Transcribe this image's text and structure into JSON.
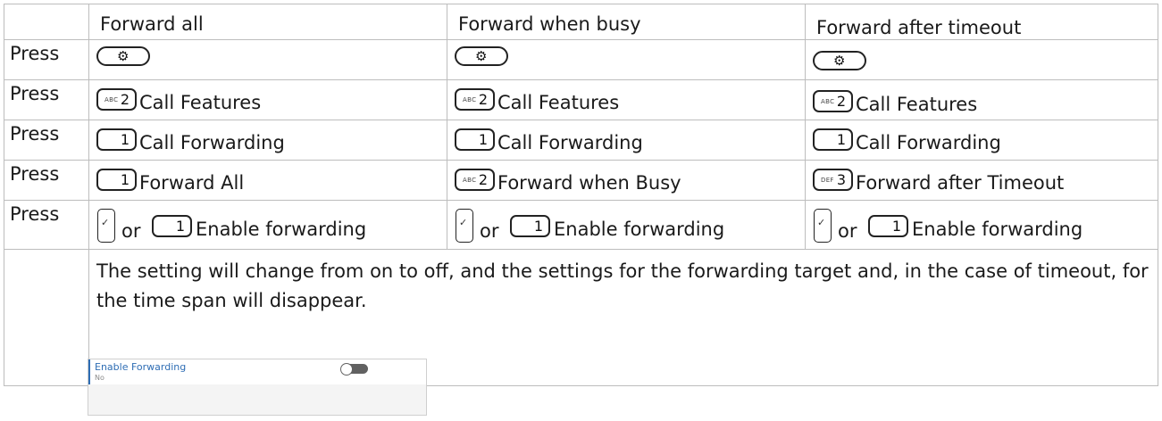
{
  "header": [
    "",
    "Forward all",
    "Forward when busy",
    "Forward after timeout"
  ],
  "press_label": "Press",
  "keys": {
    "settings": "⚙",
    "abc2": {
      "sub": "ABC",
      "digit": "2"
    },
    "one": {
      "sub": "",
      "digit": "1"
    },
    "def3": {
      "sub": "DEF",
      "digit": "3"
    },
    "ok": "✓"
  },
  "rows": {
    "call_features": "Call Features",
    "call_forwarding": "Call Forwarding",
    "forward_all": "Forward All",
    "forward_busy": "Forward when Busy",
    "forward_timeout": "Forward after Timeout",
    "or": "or",
    "enable": "Enable forwarding"
  },
  "note": "The setting will change from on to off, and the settings for the forwarding target and, in the case of timeout, for the time span will disappear.",
  "panel": {
    "title": "Enable Forwarding",
    "value": "No",
    "toggle_on": false
  }
}
